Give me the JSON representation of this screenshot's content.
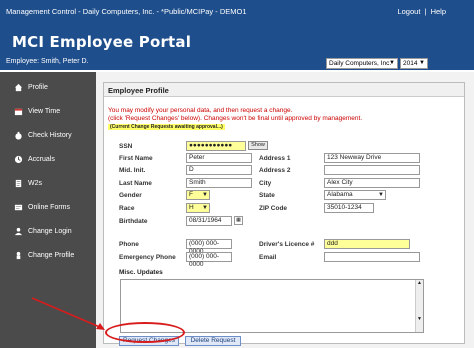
{
  "topbar": {
    "path": "Management Control - Daily Computers, Inc. - *Public/MCIPay - DEMO1",
    "logout": "Logout",
    "sep": "|",
    "help": "Help"
  },
  "header": {
    "title": "MCI Employee Portal",
    "employee": "Employee: Smith, Peter D.",
    "company_select": "Daily Computers, Inc.",
    "year_select": "2014"
  },
  "sidebar": {
    "items": [
      {
        "label": "Profile",
        "icon": "house-icon"
      },
      {
        "label": "View Time",
        "icon": "calendar-icon"
      },
      {
        "label": "Check History",
        "icon": "money-bag-icon"
      },
      {
        "label": "Accruals",
        "icon": "clock-icon"
      },
      {
        "label": "W2s",
        "icon": "document-icon"
      },
      {
        "label": "Online Forms",
        "icon": "form-icon"
      },
      {
        "label": "Change Login",
        "icon": "login-icon"
      },
      {
        "label": "Change Profile",
        "icon": "person-icon"
      }
    ]
  },
  "panel": {
    "title": "Employee Profile",
    "notice1": "You may modify your personal data, and then request a change.",
    "notice2": "(click 'Request Changes' below). Changes won't be final until approved by management.",
    "pending": "(Current Change Requests awaiting approval...)"
  },
  "form": {
    "ssn_label": "SSN",
    "ssn_value": "●●●●●●●●●●●",
    "show_label": "Show",
    "first_name_label": "First Name",
    "first_name": "Peter",
    "mid_init_label": "Mid. Init.",
    "mid_init": "D",
    "last_name_label": "Last Name",
    "last_name": "Smith",
    "gender_label": "Gender",
    "gender": "F",
    "race_label": "Race",
    "race": "H",
    "birthdate_label": "Birthdate",
    "birthdate": "08/31/1964",
    "address1_label": "Address 1",
    "address1": "123 Newway Drive",
    "address2_label": "Address 2",
    "address2": "",
    "city_label": "City",
    "city": "Alex City",
    "state_label": "State",
    "state": "Alabama",
    "zip_label": "ZIP Code",
    "zip": "35010-1234",
    "phone_label": "Phone",
    "phone": "(000) 000-0000",
    "emergency_phone_label": "Emergency Phone",
    "emergency_phone": "(000) 000-0000",
    "license_label": "Driver's Licence #",
    "license": "ddd",
    "email_label": "Email",
    "email": "",
    "misc_label": "Misc. Updates"
  },
  "actions": {
    "request_changes": "Request Changes",
    "delete_request": "Delete Request"
  },
  "colors": {
    "brand": "#1f4e8c",
    "sidebar": "#4b4b4b",
    "notice": "#cc0000",
    "highlight_ring": "#d81b1b"
  }
}
